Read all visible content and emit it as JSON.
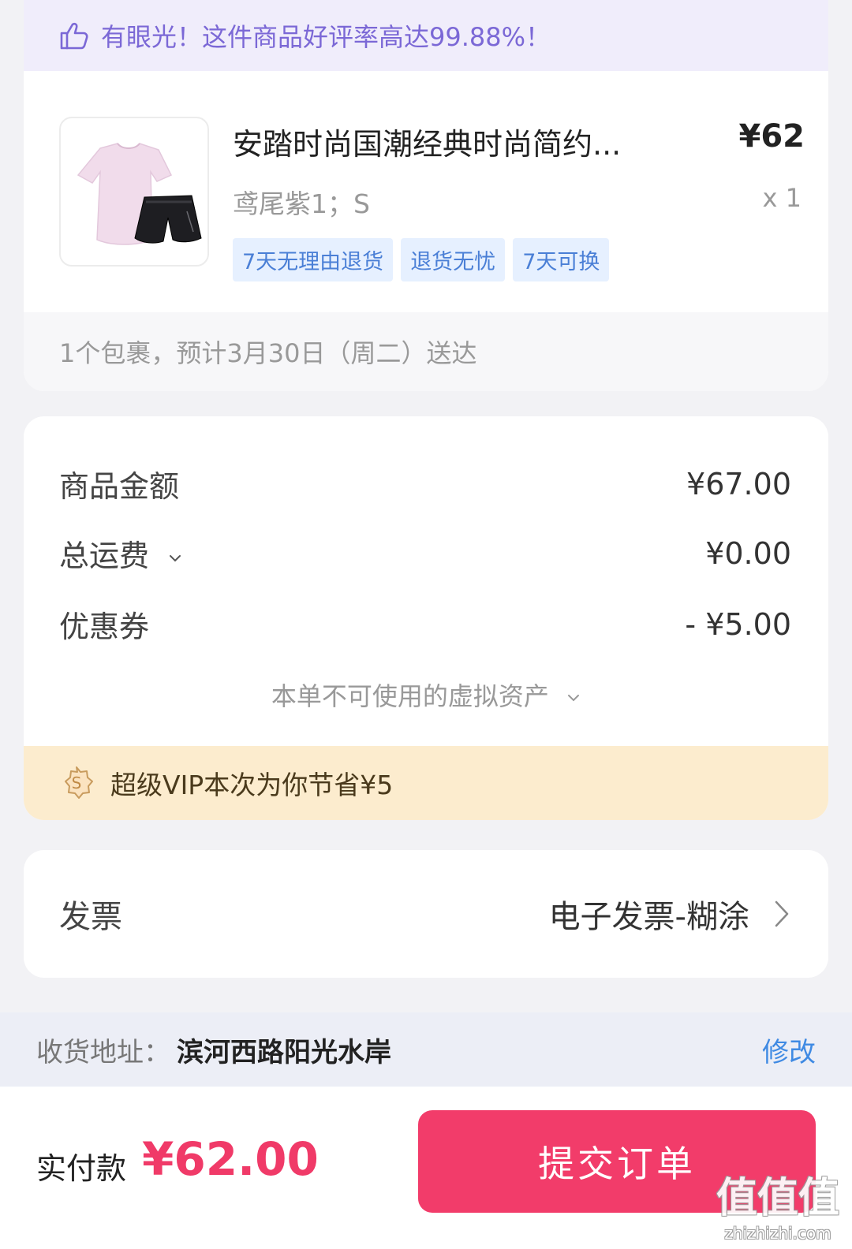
{
  "praise": {
    "text": "有眼光！这件商品好评率高达99.88%！",
    "icon": "thumbs-up-icon",
    "color": "#7b68d6"
  },
  "product": {
    "title": "安踏时尚国潮经典时尚简约...",
    "price": "¥62",
    "spec": "鸢尾紫1；S",
    "quantity": "x 1",
    "tags": [
      "7天无理由退货",
      "退货无忧",
      "7天可换"
    ]
  },
  "delivery": {
    "text": "1个包裹，预计3月30日（周二）送达"
  },
  "amounts": {
    "goods": {
      "label": "商品金额",
      "value": "¥67.00"
    },
    "shipping": {
      "label": "总运费",
      "value": "¥0.00"
    },
    "coupon": {
      "label": "优惠券",
      "value": "- ¥5.00"
    },
    "virtual_assets": "本单不可使用的虚拟资产"
  },
  "vip": {
    "text": "超级VIP本次为你节省¥5",
    "icon": "vip-badge-icon"
  },
  "invoice": {
    "label": "发票",
    "value": "电子发票-糊涂"
  },
  "address": {
    "label": "收货地址：",
    "value": "滨河西路阳光水岸",
    "edit_label": "修改"
  },
  "checkout": {
    "pay_label": "实付款",
    "pay_amount": "¥62.00",
    "submit_label": "提交订单",
    "accent": "#f23c6a"
  },
  "watermark": {
    "main": "值值值",
    "sub": "zhizhizhi.com"
  }
}
